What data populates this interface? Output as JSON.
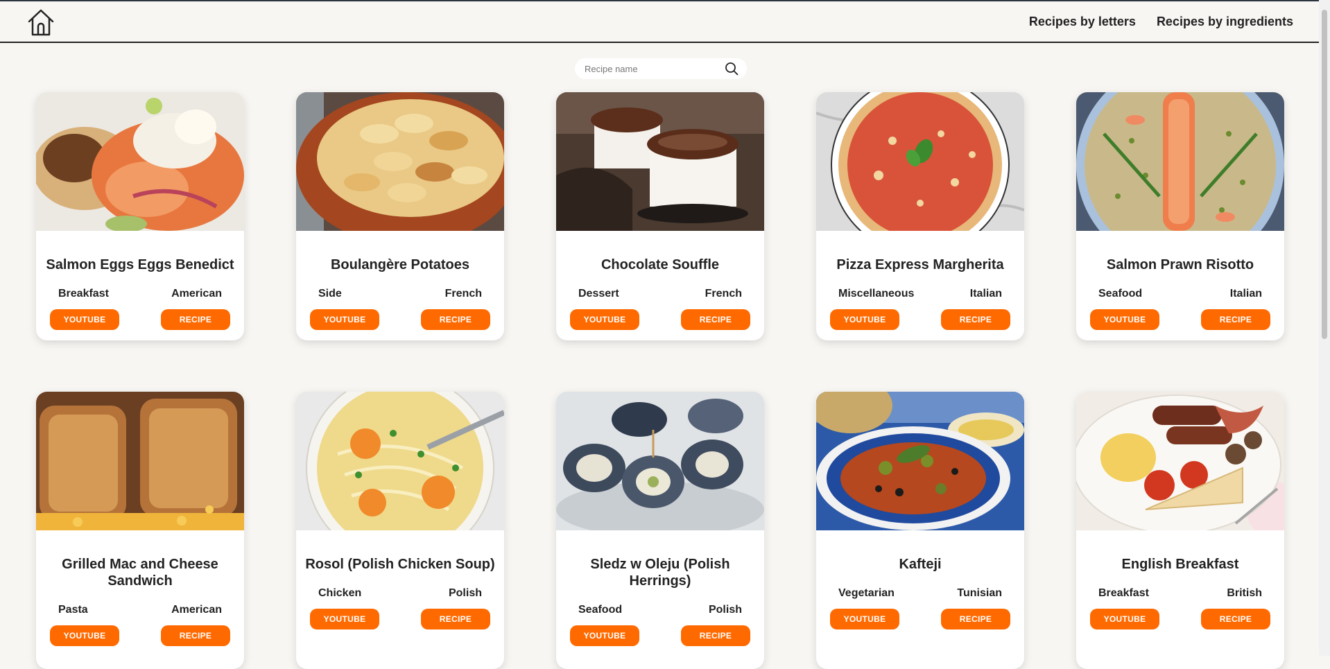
{
  "nav": {
    "links": [
      "Recipes by letters",
      "Recipes by ingredients"
    ]
  },
  "search": {
    "placeholder": "Recipe name",
    "value": ""
  },
  "buttons": {
    "youtube": "YOUTUBE",
    "recipe": "RECIPE"
  },
  "colors": {
    "accent": "#ff6a00",
    "background": "#f8f6f3"
  },
  "recipes": [
    {
      "title": "Salmon Eggs Eggs Benedict",
      "category": "Breakfast",
      "area": "American"
    },
    {
      "title": "Boulangère Potatoes",
      "category": "Side",
      "area": "French"
    },
    {
      "title": "Chocolate Souffle",
      "category": "Dessert",
      "area": "French"
    },
    {
      "title": "Pizza Express Margherita",
      "category": "Miscellaneous",
      "area": "Italian"
    },
    {
      "title": "Salmon Prawn Risotto",
      "category": "Seafood",
      "area": "Italian"
    },
    {
      "title": "Grilled Mac and Cheese Sandwich",
      "category": "Pasta",
      "area": "American"
    },
    {
      "title": "Rosol (Polish Chicken Soup)",
      "category": "Chicken",
      "area": "Polish"
    },
    {
      "title": "Sledz w Oleju (Polish Herrings)",
      "category": "Seafood",
      "area": "Polish"
    },
    {
      "title": "Kafteji",
      "category": "Vegetarian",
      "area": "Tunisian"
    },
    {
      "title": "English Breakfast",
      "category": "Breakfast",
      "area": "British"
    }
  ]
}
